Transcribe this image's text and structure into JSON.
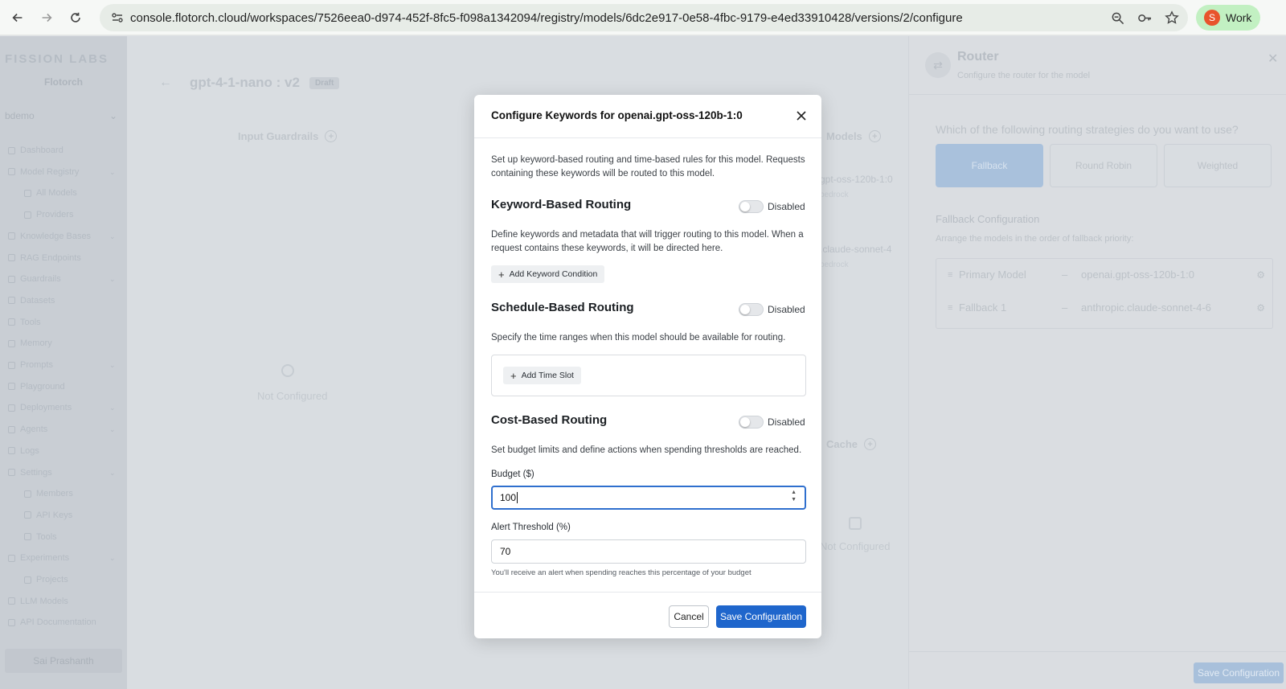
{
  "browser": {
    "url": "console.flotorch.cloud/workspaces/7526eea0-d974-452f-8fc5-f098a1342094/registry/models/6dc2e917-0e58-4fbc-9179-e4ed33910428/versions/2/configure",
    "profile_initial": "S",
    "profile_label": "Work"
  },
  "sidebar": {
    "logo": "FISSION LABS",
    "brand": "Flotorch",
    "workspace": "bdemo",
    "items": [
      {
        "label": "Dashboard",
        "level": 0
      },
      {
        "label": "Model Registry",
        "level": 0
      },
      {
        "label": "All Models",
        "level": 1
      },
      {
        "label": "Providers",
        "level": 1
      },
      {
        "label": "Knowledge Bases",
        "level": 0
      },
      {
        "label": "RAG Endpoints",
        "level": 0
      },
      {
        "label": "Guardrails",
        "level": 0
      },
      {
        "label": "Datasets",
        "level": 0
      },
      {
        "label": "Tools",
        "level": 0
      },
      {
        "label": "Memory",
        "level": 0
      },
      {
        "label": "Prompts",
        "level": 0
      },
      {
        "label": "Playground",
        "level": 0
      },
      {
        "label": "Deployments",
        "level": 0
      },
      {
        "label": "Agents",
        "level": 0
      },
      {
        "label": "Logs",
        "level": 0
      },
      {
        "label": "Settings",
        "level": 0
      },
      {
        "label": "Members",
        "level": 1
      },
      {
        "label": "API Keys",
        "level": 1
      },
      {
        "label": "Tools",
        "level": 1
      },
      {
        "label": "Experiments",
        "level": 0
      },
      {
        "label": "Projects",
        "level": 1
      },
      {
        "label": "LLM Models",
        "level": 0
      },
      {
        "label": "API Documentation",
        "level": 0
      }
    ],
    "user": "Sai Prashanth"
  },
  "main": {
    "title": "gpt-4-1-nano : v2",
    "badge": "Draft",
    "input_guardrails": "Input Guardrails",
    "models_label": "Models",
    "model1": "gpt-oss-120b-1:0",
    "model1_sub": "bedrock",
    "model2": ".claude-sonnet-4",
    "model2_sub": "bedrock",
    "not_configured": "Not Configured",
    "cache": "Cache",
    "not_configured_2": "Not Configured"
  },
  "router": {
    "title": "Router",
    "subtitle": "Configure the router for the model",
    "question": "Which of the following routing strategies do you want to use?",
    "strategies": [
      "Fallback",
      "Round Robin",
      "Weighted"
    ],
    "fallback_title": "Fallback Configuration",
    "fallback_sub": "Arrange the models in the order of fallback priority:",
    "rows": [
      {
        "name": "Primary Model",
        "model": "openai.gpt-oss-120b-1:0"
      },
      {
        "name": "Fallback 1",
        "model": "anthropic.claude-sonnet-4-6"
      }
    ],
    "save": "Save Configuration"
  },
  "modal": {
    "title": "Configure Keywords for openai.gpt-oss-120b-1:0",
    "intro": "Set up keyword-based routing and time-based rules for this model. Requests containing these keywords will be routed to this model.",
    "keyword": {
      "title": "Keyword-Based Routing",
      "status": "Disabled",
      "desc": "Define keywords and metadata that will trigger routing to this model. When a request contains these keywords, it will be directed here.",
      "add": "Add Keyword Condition"
    },
    "schedule": {
      "title": "Schedule-Based Routing",
      "status": "Disabled",
      "desc": "Specify the time ranges when this model should be available for routing.",
      "add": "Add Time Slot"
    },
    "cost": {
      "title": "Cost-Based Routing",
      "status": "Disabled",
      "desc": "Set budget limits and define actions when spending thresholds are reached.",
      "budget_label": "Budget ($)",
      "budget_value": "100",
      "alert_label": "Alert Threshold (%)",
      "alert_value": "70",
      "help": "You'll receive an alert when spending reaches this percentage of your budget"
    },
    "cancel": "Cancel",
    "save": "Save Configuration"
  }
}
